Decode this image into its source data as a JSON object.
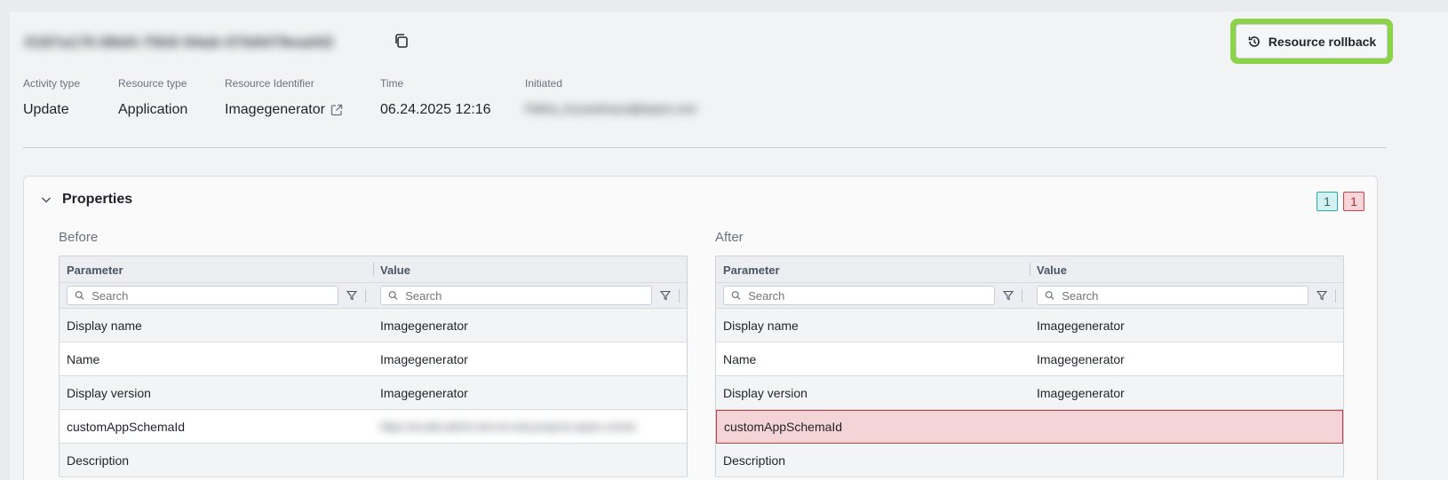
{
  "header": {
    "activity_id": "0187a170-88d4-70b5-94ab-07b8479ead42",
    "rollback_label": "Resource rollback"
  },
  "meta": [
    {
      "label": "Activity type",
      "value": "Update"
    },
    {
      "label": "Resource type",
      "value": "Application"
    },
    {
      "label": "Resource Identifier",
      "value": "Imagegenerator"
    },
    {
      "label": "Time",
      "value": "06.24.2025 12:16"
    },
    {
      "label": "Initiated",
      "value": "Pakha_Kryvashnyna@epam.com"
    }
  ],
  "properties": {
    "title": "Properties",
    "added_count": "1",
    "removed_count": "1",
    "before": {
      "label": "Before",
      "headers": {
        "parameter": "Parameter",
        "value": "Value"
      },
      "search_placeholder": "Search",
      "rows": [
        {
          "parameter": "Display name",
          "value": "Imagegenerator"
        },
        {
          "parameter": "Name",
          "value": "Imagegenerator"
        },
        {
          "parameter": "Display version",
          "value": "Imagegenerator"
        },
        {
          "parameter": "customAppSchemaId",
          "value": "https://ai-dial-admin-test.int-ssta.projects.epam.com/ai"
        },
        {
          "parameter": "Description",
          "value": ""
        }
      ]
    },
    "after": {
      "label": "After",
      "headers": {
        "parameter": "Parameter",
        "value": "Value"
      },
      "search_placeholder": "Search",
      "rows": [
        {
          "parameter": "Display name",
          "value": "Imagegenerator"
        },
        {
          "parameter": "Name",
          "value": "Imagegenerator"
        },
        {
          "parameter": "Display version",
          "value": "Imagegenerator"
        },
        {
          "parameter": "customAppSchemaId",
          "value": ""
        },
        {
          "parameter": "Description",
          "value": ""
        }
      ]
    }
  },
  "colors": {
    "highlight_border": "#8cd34a",
    "changed_row_bg": "#f4d4d7",
    "changed_row_border": "#c33a44"
  }
}
